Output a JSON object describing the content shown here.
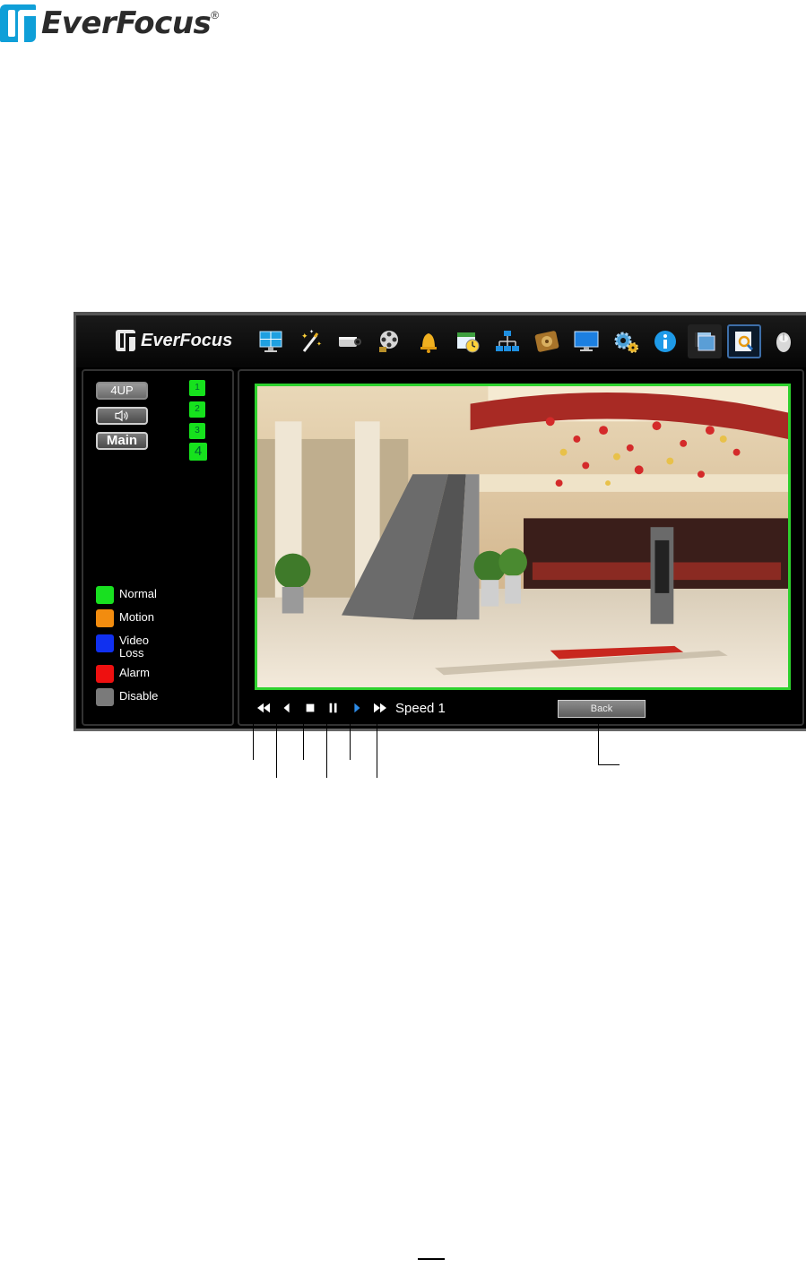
{
  "document": {
    "brand": "EverFocus",
    "registered_mark": "®"
  },
  "app": {
    "brand": "EverFocus",
    "toolbar": [
      {
        "icon": "live-view-icon"
      },
      {
        "icon": "wizard-icon"
      },
      {
        "icon": "camera-icon"
      },
      {
        "icon": "record-icon"
      },
      {
        "icon": "alarm-bell-icon"
      },
      {
        "icon": "schedule-icon"
      },
      {
        "icon": "network-icon"
      },
      {
        "icon": "disk-icon"
      },
      {
        "icon": "display-icon"
      },
      {
        "icon": "system-settings-icon"
      },
      {
        "icon": "info-icon"
      },
      {
        "icon": "playback-icon"
      },
      {
        "icon": "search-playback-icon"
      },
      {
        "icon": "logout-icon"
      }
    ],
    "left_panel": {
      "layout_button": "4UP",
      "audio_icon": "speaker-icon",
      "main_button": "Main",
      "channels": [
        "1",
        "2",
        "3",
        "4"
      ],
      "legend": [
        {
          "label": "Normal",
          "color": "#18e020"
        },
        {
          "label": "Motion",
          "color": "#f28c0f"
        },
        {
          "label": "Video Loss",
          "color": "#1030f0"
        },
        {
          "label": "Alarm",
          "color": "#ee1010"
        },
        {
          "label": "Disable",
          "color": "#7a7a7a"
        }
      ]
    },
    "playback": {
      "controls": [
        "fast-rewind-icon",
        "rewind-icon",
        "stop-icon",
        "pause-icon",
        "play-icon",
        "fast-forward-icon"
      ],
      "speed_text": "Speed 1",
      "back_label": "Back",
      "frame_color": "#2ed12e"
    }
  }
}
